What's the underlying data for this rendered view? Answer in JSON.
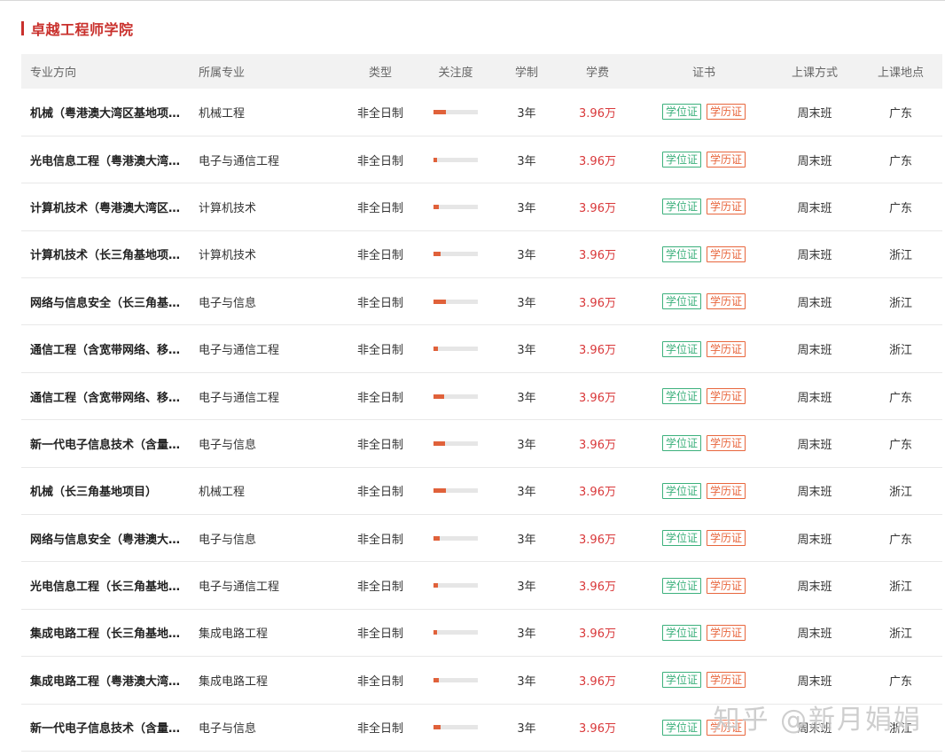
{
  "section": {
    "title": "卓越工程师学院"
  },
  "columns": [
    "专业方向",
    "所属专业",
    "类型",
    "关注度",
    "学制",
    "学费",
    "证书",
    "上课方式",
    "上课地点"
  ],
  "badges": {
    "degree": "学位证",
    "diploma": "学历证"
  },
  "rows": [
    {
      "direction": "机械（粤港澳大湾区基地项目）",
      "major": "机械工程",
      "type": "非全日制",
      "attention": 0.28,
      "duration": "3年",
      "fee": "3.96万",
      "mode": "周末班",
      "location": "广东"
    },
    {
      "direction": "光电信息工程（粤港澳大湾区基地项目）",
      "major": "电子与通信工程",
      "type": "非全日制",
      "attention": 0.08,
      "duration": "3年",
      "fee": "3.96万",
      "mode": "周末班",
      "location": "广东"
    },
    {
      "direction": "计算机技术（粤港澳大湾区基地项目）",
      "major": "计算机技术",
      "type": "非全日制",
      "attention": 0.12,
      "duration": "3年",
      "fee": "3.96万",
      "mode": "周末班",
      "location": "广东"
    },
    {
      "direction": "计算机技术（长三角基地项目）",
      "major": "计算机技术",
      "type": "非全日制",
      "attention": 0.16,
      "duration": "3年",
      "fee": "3.96万",
      "mode": "周末班",
      "location": "浙江"
    },
    {
      "direction": "网络与信息安全（长三角基地项目）",
      "major": "电子与信息",
      "type": "非全日制",
      "attention": 0.28,
      "duration": "3年",
      "fee": "3.96万",
      "mode": "周末班",
      "location": "浙江"
    },
    {
      "direction": "通信工程（含宽带网络、移动通信等）",
      "major": "电子与通信工程",
      "type": "非全日制",
      "attention": 0.1,
      "duration": "3年",
      "fee": "3.96万",
      "mode": "周末班",
      "location": "浙江"
    },
    {
      "direction": "通信工程（含宽带网络、移动通信等）",
      "major": "电子与通信工程",
      "type": "非全日制",
      "attention": 0.24,
      "duration": "3年",
      "fee": "3.96万",
      "mode": "周末班",
      "location": "广东"
    },
    {
      "direction": "新一代电子信息技术（含量子技术等）",
      "major": "电子与信息",
      "type": "非全日制",
      "attention": 0.26,
      "duration": "3年",
      "fee": "3.96万",
      "mode": "周末班",
      "location": "广东"
    },
    {
      "direction": "机械（长三角基地项目）",
      "major": "机械工程",
      "type": "非全日制",
      "attention": 0.28,
      "duration": "3年",
      "fee": "3.96万",
      "mode": "周末班",
      "location": "浙江"
    },
    {
      "direction": "网络与信息安全（粤港澳大湾区基地项目）",
      "major": "电子与信息",
      "type": "非全日制",
      "attention": 0.14,
      "duration": "3年",
      "fee": "3.96万",
      "mode": "周末班",
      "location": "广东"
    },
    {
      "direction": "光电信息工程（长三角基地项目）",
      "major": "电子与通信工程",
      "type": "非全日制",
      "attention": 0.1,
      "duration": "3年",
      "fee": "3.96万",
      "mode": "周末班",
      "location": "浙江"
    },
    {
      "direction": "集成电路工程（长三角基地项目）",
      "major": "集成电路工程",
      "type": "非全日制",
      "attention": 0.08,
      "duration": "3年",
      "fee": "3.96万",
      "mode": "周末班",
      "location": "浙江"
    },
    {
      "direction": "集成电路工程（粤港澳大湾区基地项目）",
      "major": "集成电路工程",
      "type": "非全日制",
      "attention": 0.12,
      "duration": "3年",
      "fee": "3.96万",
      "mode": "周末班",
      "location": "广东"
    },
    {
      "direction": "新一代电子信息技术（含量子技术等）",
      "major": "电子与信息",
      "type": "非全日制",
      "attention": 0.16,
      "duration": "3年",
      "fee": "3.96万",
      "mode": "周末班",
      "location": "浙江"
    }
  ],
  "watermark": "知乎 @新月娟娟"
}
